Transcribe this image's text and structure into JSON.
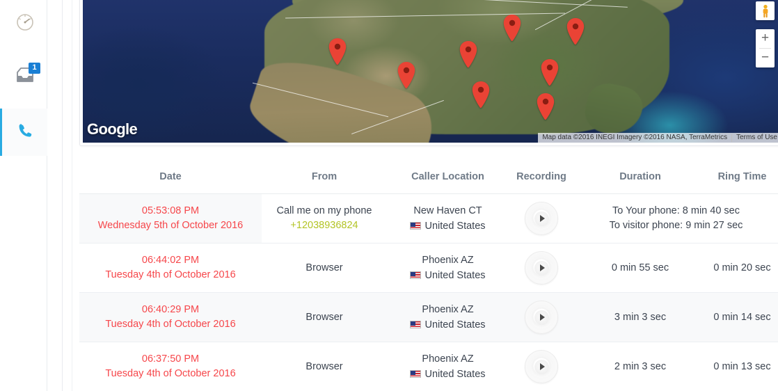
{
  "sidebar": {
    "items": [
      {
        "name": "dashboard",
        "icon": "gauge-icon",
        "active": false,
        "badge": null
      },
      {
        "name": "inbox",
        "icon": "inbox-icon",
        "active": false,
        "badge": "1"
      },
      {
        "name": "calls",
        "icon": "phone-icon",
        "active": true,
        "badge": null
      }
    ],
    "badge_color": "#1a7fd4",
    "active_color": "#29abe2"
  },
  "map": {
    "provider_logo": "Google",
    "attribution": "Map data ©2016 INEGI Imagery ©2016 NASA, TerraMetrics",
    "terms_label": "Terms of Use",
    "zoom_in_label": "+",
    "zoom_out_label": "−",
    "pegman_label": "street-view-pegman",
    "marker_color": "#ea4335",
    "markers": [
      {
        "label": "marker-1",
        "x": 36.5,
        "y": 46.0
      },
      {
        "label": "marker-2",
        "x": 46.3,
        "y": 62.5
      },
      {
        "label": "marker-3",
        "x": 55.2,
        "y": 48.0
      },
      {
        "label": "marker-4",
        "x": 57.0,
        "y": 76.0
      },
      {
        "label": "marker-5",
        "x": 61.5,
        "y": 30.0
      },
      {
        "label": "marker-6",
        "x": 66.8,
        "y": 60.5
      },
      {
        "label": "marker-7",
        "x": 66.2,
        "y": 84.0
      },
      {
        "label": "marker-8",
        "x": 70.5,
        "y": 32.0
      }
    ]
  },
  "table": {
    "headers": {
      "date": "Date",
      "from": "From",
      "caller_location": "Caller Location",
      "recording": "Recording",
      "duration": "Duration",
      "ring_time": "Ring Time"
    },
    "rows": [
      {
        "time": "05:53:08 PM",
        "date": "Wednesday 5th of October 2016",
        "from_main": "Call me on my phone",
        "from_phone": "+12038936824",
        "city": "New Haven CT",
        "country": "United States",
        "recording": "play-button",
        "duration_line1": "To Your phone: 8 min 40 sec",
        "duration_line2": "To visitor phone: 9 min 27 sec",
        "ring_time": ""
      },
      {
        "time": "06:44:02 PM",
        "date": "Tuesday 4th of October 2016",
        "from_main": "Browser",
        "from_phone": "",
        "city": "Phoenix AZ",
        "country": "United States",
        "recording": "play-button",
        "duration_line1": "0 min 55 sec",
        "duration_line2": "",
        "ring_time": "0 min 20 sec"
      },
      {
        "time": "06:40:29 PM",
        "date": "Tuesday 4th of October 2016",
        "from_main": "Browser",
        "from_phone": "",
        "city": "Phoenix AZ",
        "country": "United States",
        "recording": "play-button",
        "duration_line1": "3 min 3 sec",
        "duration_line2": "",
        "ring_time": "0 min 14 sec"
      },
      {
        "time": "06:37:50 PM",
        "date": "Tuesday 4th of October 2016",
        "from_main": "Browser",
        "from_phone": "",
        "city": "Phoenix AZ",
        "country": "United States",
        "recording": "play-button",
        "duration_line1": "2 min 3 sec",
        "duration_line2": "",
        "ring_time": "0 min 13 sec"
      }
    ]
  },
  "colors": {
    "date_red": "#f6464a",
    "phone_green": "#b3c425",
    "header_gray": "#6f7a87",
    "row_alt": "#f8f9fa"
  }
}
